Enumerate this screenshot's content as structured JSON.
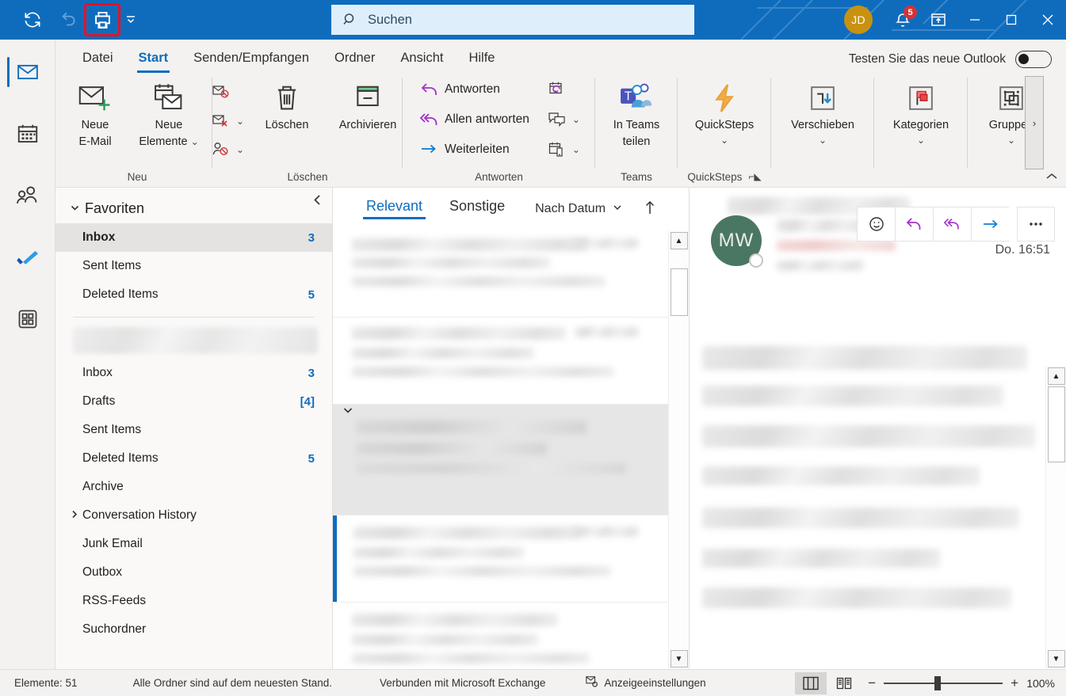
{
  "titlebar": {
    "quick_access": [
      {
        "name": "sync-icon",
        "label": "Senden/Empfangen aktualisieren",
        "state": "enabled"
      },
      {
        "name": "undo-icon",
        "label": "Rückgängig",
        "state": "disabled"
      },
      {
        "name": "print-icon",
        "label": "Drucken",
        "state": "highlighted"
      }
    ],
    "qat_more_label": "Symbolleiste für den Schnellzugriff anpassen",
    "highlight_color": "#e81123",
    "accent_color": "#0f6cbd",
    "avatar_initials": "JD",
    "avatar_color": "#c89211",
    "notification_count": "5",
    "window_buttons": [
      "minimize",
      "maximize",
      "close"
    ]
  },
  "search": {
    "placeholder": "Suchen",
    "value": ""
  },
  "ribbon": {
    "tabs": [
      {
        "label": "Datei",
        "active": false
      },
      {
        "label": "Start",
        "active": true
      },
      {
        "label": "Senden/Empfangen",
        "active": false
      },
      {
        "label": "Ordner",
        "active": false
      },
      {
        "label": "Ansicht",
        "active": false
      },
      {
        "label": "Hilfe",
        "active": false
      }
    ],
    "new_outlook_label": "Testen Sie das neue Outlook",
    "new_outlook_toggle": "off",
    "groups": [
      {
        "name": "Neu",
        "label": "Neu",
        "buttons": [
          {
            "label_line1": "Neue",
            "label_line2": "E-Mail",
            "icon": "new-mail-icon"
          },
          {
            "label_line1": "Neue",
            "label_line2": "Elemente",
            "icon": "new-items-icon",
            "dropdown": true
          }
        ]
      },
      {
        "name": "Löschen",
        "label": "Löschen",
        "small_buttons": [
          {
            "label": "",
            "icon": "ignore-icon"
          },
          {
            "label": "",
            "icon": "junk-icon",
            "dropdown": true
          },
          {
            "label": "",
            "icon": "block-sender-icon",
            "dropdown": true
          }
        ],
        "buttons": [
          {
            "label_line1": "Löschen",
            "label_line2": "",
            "icon": "delete-icon"
          },
          {
            "label_line1": "Archivieren",
            "label_line2": "",
            "icon": "archive-icon"
          }
        ]
      },
      {
        "name": "Antworten",
        "label": "Antworten",
        "text_buttons": [
          {
            "label": "Antworten",
            "icon": "reply-icon"
          },
          {
            "label": "Allen antworten",
            "icon": "reply-all-icon"
          },
          {
            "label": "Weiterleiten",
            "icon": "forward-icon"
          }
        ],
        "small_buttons": [
          {
            "label": "",
            "icon": "meeting-reply-icon"
          },
          {
            "label": "",
            "icon": "im-reply-icon",
            "dropdown": true
          },
          {
            "label": "",
            "icon": "reply-with-mobile-icon",
            "dropdown": true
          }
        ]
      },
      {
        "name": "Teams",
        "label": "Teams",
        "buttons": [
          {
            "label_line1": "In Teams",
            "label_line2": "teilen",
            "icon": "teams-icon"
          }
        ]
      },
      {
        "name": "QuickSteps",
        "label": "QuickSteps",
        "has_dialog_launcher": true,
        "buttons": [
          {
            "label_line1": "QuickSteps",
            "label_line2": "",
            "icon": "quicksteps-icon",
            "dropdown": true
          }
        ]
      },
      {
        "name": "Verschieben",
        "label": "",
        "buttons": [
          {
            "label_line1": "Verschieben",
            "label_line2": "",
            "icon": "move-icon",
            "dropdown": true
          }
        ]
      },
      {
        "name": "Kategorien",
        "label": "",
        "buttons": [
          {
            "label_line1": "Kategorien",
            "label_line2": "",
            "icon": "categories-flag-icon",
            "dropdown": true
          }
        ]
      },
      {
        "name": "Gruppen",
        "label": "",
        "buttons": [
          {
            "label_line1": "Gruppen",
            "label_line2": "",
            "icon": "groups-icon",
            "dropdown": true
          }
        ]
      }
    ],
    "overflow_label": "›",
    "collapse_label": "^"
  },
  "rail": {
    "items": [
      {
        "name": "mail",
        "icon": "mail-icon",
        "active": true
      },
      {
        "name": "calendar",
        "icon": "calendar-icon",
        "active": false
      },
      {
        "name": "people",
        "icon": "people-icon",
        "active": false
      },
      {
        "name": "todo",
        "icon": "todo-check-icon",
        "active": false
      },
      {
        "name": "apps",
        "icon": "apps-grid-icon",
        "active": false
      }
    ]
  },
  "folder_pane": {
    "favorites_header": "Favoriten",
    "favorites": [
      {
        "label": "Inbox",
        "count": "3",
        "selected": true
      },
      {
        "label": "Sent Items",
        "count": "",
        "selected": false
      },
      {
        "label": "Deleted Items",
        "count": "5",
        "selected": false
      }
    ],
    "account_name_blurred": true,
    "folders": [
      {
        "label": "Inbox",
        "count": "3",
        "expandable": false
      },
      {
        "label": "Drafts",
        "count": "[4]",
        "expandable": false
      },
      {
        "label": "Sent Items",
        "count": "",
        "expandable": false
      },
      {
        "label": "Deleted Items",
        "count": "5",
        "expandable": false
      },
      {
        "label": "Archive",
        "count": "",
        "expandable": false
      },
      {
        "label": "Conversation History",
        "count": "",
        "expandable": true
      },
      {
        "label": "Junk Email",
        "count": "",
        "expandable": false
      },
      {
        "label": "Outbox",
        "count": "",
        "expandable": false
      },
      {
        "label": "RSS-Feeds",
        "count": "",
        "expandable": false
      },
      {
        "label": "Suchordner",
        "count": "",
        "expandable": false
      }
    ]
  },
  "message_list": {
    "tabs": [
      {
        "label": "Relevant",
        "active": true
      },
      {
        "label": "Sonstige",
        "active": false
      }
    ],
    "sort_label": "Nach Datum",
    "sort_direction_icon": "sort-ascending-arrow-icon",
    "rows_blurred": true
  },
  "reading_pane": {
    "sender_initials": "MW",
    "sender_avatar_color": "#4a7762",
    "timestamp": "Do. 16:51",
    "actions": [
      {
        "name": "react-emoji",
        "icon": "smiley-icon"
      },
      {
        "name": "reply",
        "icon": "reply-icon"
      },
      {
        "name": "reply-all",
        "icon": "reply-all-icon"
      },
      {
        "name": "forward",
        "icon": "forward-arrow-icon"
      },
      {
        "name": "more",
        "icon": "ellipsis-icon"
      }
    ]
  },
  "status_bar": {
    "items_count": "Elemente: 51",
    "sync_status": "Alle Ordner sind auf dem neuesten Stand.",
    "connection": "Verbunden mit Microsoft Exchange",
    "view_settings": "Anzeigeeinstellungen",
    "zoom_minus": "−",
    "zoom_plus": "+",
    "zoom_level": "100%"
  }
}
